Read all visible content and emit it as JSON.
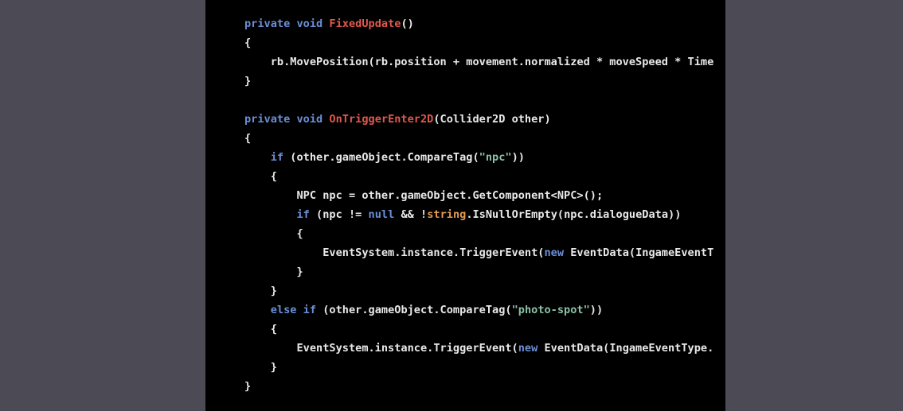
{
  "code": {
    "lines": [
      [
        {
          "t": "private void ",
          "c": "kw"
        },
        {
          "t": "FixedUpdate",
          "c": "fn"
        },
        {
          "t": "()",
          "c": "p"
        }
      ],
      [
        {
          "t": "{",
          "c": "p"
        }
      ],
      [
        {
          "t": "    rb.MovePosition(rb.position + movement.normalized * moveSpeed * Time",
          "c": "p"
        }
      ],
      [
        {
          "t": "}",
          "c": "p"
        }
      ],
      [],
      [
        {
          "t": "private void ",
          "c": "kw"
        },
        {
          "t": "OnTriggerEnter2D",
          "c": "fn"
        },
        {
          "t": "(Collider2D other)",
          "c": "p"
        }
      ],
      [
        {
          "t": "{",
          "c": "p"
        }
      ],
      [
        {
          "t": "    ",
          "c": "p"
        },
        {
          "t": "if",
          "c": "kw"
        },
        {
          "t": " (other.gameObject.CompareTag(",
          "c": "p"
        },
        {
          "t": "\"npc\"",
          "c": "str"
        },
        {
          "t": "))",
          "c": "p"
        }
      ],
      [
        {
          "t": "    {",
          "c": "p"
        }
      ],
      [
        {
          "t": "        NPC npc = other.gameObject.GetComponent<NPC>();",
          "c": "p"
        }
      ],
      [
        {
          "t": "        ",
          "c": "p"
        },
        {
          "t": "if",
          "c": "kw"
        },
        {
          "t": " (npc != ",
          "c": "p"
        },
        {
          "t": "null",
          "c": "kw"
        },
        {
          "t": " && !",
          "c": "p"
        },
        {
          "t": "string",
          "c": "typ"
        },
        {
          "t": ".IsNullOrEmpty(npc.dialogueData))",
          "c": "p"
        }
      ],
      [
        {
          "t": "        {",
          "c": "p"
        }
      ],
      [
        {
          "t": "            EventSystem.instance.TriggerEvent(",
          "c": "p"
        },
        {
          "t": "new",
          "c": "kw"
        },
        {
          "t": " EventData(IngameEventT",
          "c": "p"
        }
      ],
      [
        {
          "t": "        }",
          "c": "p"
        }
      ],
      [
        {
          "t": "    }",
          "c": "p"
        }
      ],
      [
        {
          "t": "    ",
          "c": "p"
        },
        {
          "t": "else if",
          "c": "kw"
        },
        {
          "t": " (other.gameObject.CompareTag(",
          "c": "p"
        },
        {
          "t": "\"photo-spot\"",
          "c": "str"
        },
        {
          "t": "))",
          "c": "p"
        }
      ],
      [
        {
          "t": "    {",
          "c": "p"
        }
      ],
      [
        {
          "t": "        EventSystem.instance.TriggerEvent(",
          "c": "p"
        },
        {
          "t": "new",
          "c": "kw"
        },
        {
          "t": " EventData(IngameEventType.",
          "c": "p"
        }
      ],
      [
        {
          "t": "    }",
          "c": "p"
        }
      ],
      [
        {
          "t": "}",
          "c": "p"
        }
      ]
    ]
  },
  "colors": {
    "background": "#4b4a55",
    "panel": "#000000",
    "plain": "#e9e9e9",
    "keyword": "#6b8fd6",
    "function": "#e0584e",
    "string": "#8bc0a6",
    "type": "#e29b52"
  }
}
